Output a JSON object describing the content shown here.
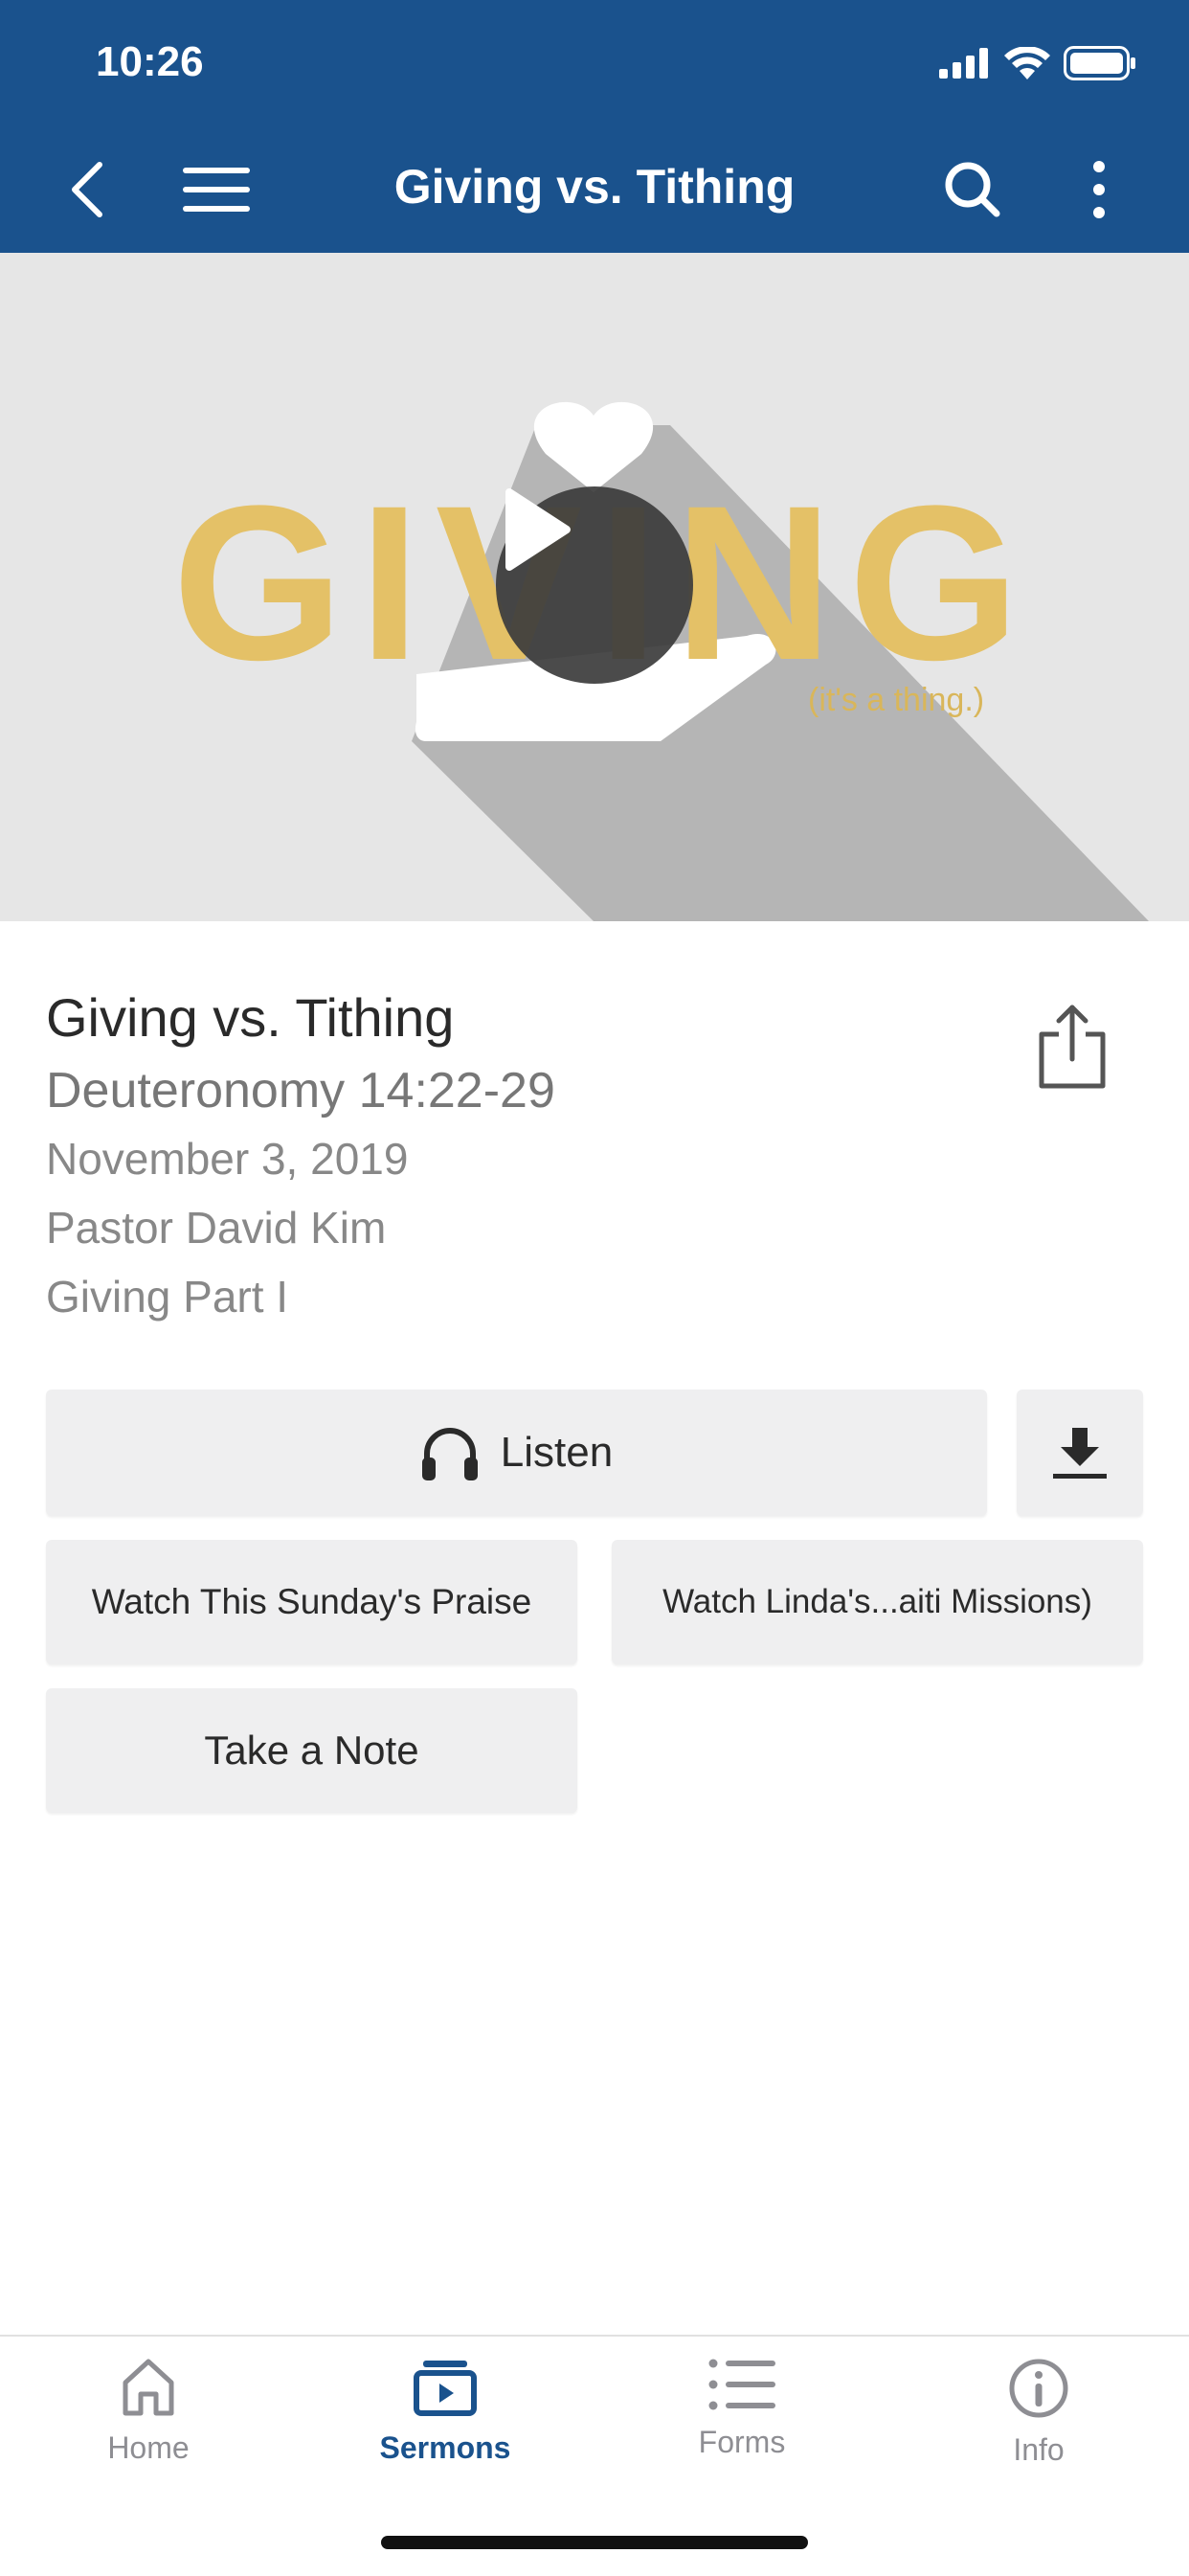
{
  "status_bar": {
    "time": "10:26"
  },
  "nav": {
    "title": "Giving vs. Tithing"
  },
  "hero": {
    "big_text": "GIVING",
    "small_text": "(it's a thing.)"
  },
  "sermon": {
    "title": "Giving vs. Tithing",
    "scripture": "Deuteronomy 14:22-29",
    "date": "November 3, 2019",
    "speaker": "Pastor David Kim",
    "series": "Giving Part I"
  },
  "buttons": {
    "listen": "Listen",
    "watch_praise": "Watch This Sunday's Praise",
    "watch_linda": "Watch Linda's...aiti Missions)",
    "take_note": "Take a Note"
  },
  "tabs": [
    {
      "label": "Home",
      "icon": "home-icon"
    },
    {
      "label": "Sermons",
      "icon": "sermons-icon"
    },
    {
      "label": "Forms",
      "icon": "forms-icon"
    },
    {
      "label": "Info",
      "icon": "info-icon"
    }
  ],
  "colors": {
    "nav_blue": "#1a528d",
    "gold": "#e4c167",
    "button_bg": "#efeff0",
    "tab_inactive": "#8e8e93"
  }
}
